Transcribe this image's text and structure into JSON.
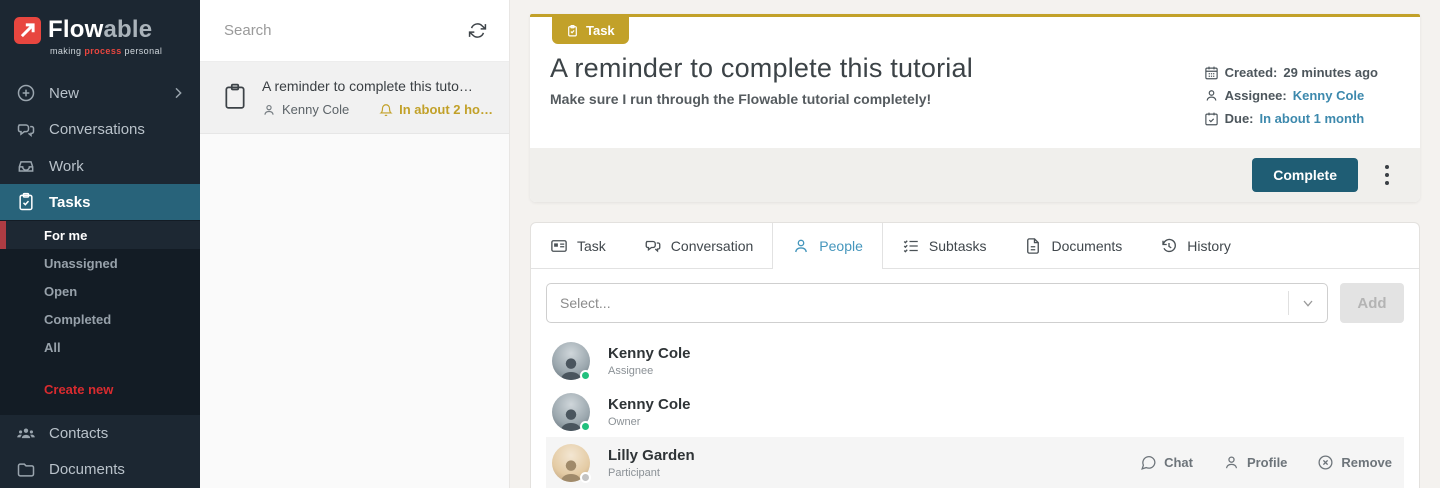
{
  "brand": {
    "name_primary": "Flow",
    "name_secondary": "able",
    "tagline_1": "making ",
    "tagline_accent": "process",
    "tagline_2": " personal"
  },
  "sidebar": {
    "items": [
      {
        "label": "New"
      },
      {
        "label": "Conversations"
      },
      {
        "label": "Work"
      },
      {
        "label": "Tasks"
      },
      {
        "label": "Contacts"
      },
      {
        "label": "Documents"
      }
    ],
    "task_filters": [
      {
        "label": "For me"
      },
      {
        "label": "Unassigned"
      },
      {
        "label": "Open"
      },
      {
        "label": "Completed"
      },
      {
        "label": "All"
      }
    ],
    "create_new_label": "Create new"
  },
  "task_list": {
    "search_placeholder": "Search",
    "items": [
      {
        "title": "A reminder to complete this tuto…",
        "assignee": "Kenny Cole",
        "due": "In about 2 ho…"
      }
    ]
  },
  "task_detail": {
    "badge": "Task",
    "title": "A reminder to complete this tutorial",
    "description": "Make sure I run through the Flowable tutorial completely!",
    "created_label": "Created:",
    "created_value": "29 minutes ago",
    "assignee_label": "Assignee:",
    "assignee_value": "Kenny Cole",
    "due_label": "Due:",
    "due_value": "In about 1 month",
    "complete_button": "Complete"
  },
  "tabs": [
    {
      "label": "Task"
    },
    {
      "label": "Conversation"
    },
    {
      "label": "People",
      "active": true
    },
    {
      "label": "Subtasks"
    },
    {
      "label": "Documents"
    },
    {
      "label": "History"
    }
  ],
  "people_panel": {
    "select_placeholder": "Select...",
    "add_button": "Add",
    "people": [
      {
        "name": "Kenny Cole",
        "role": "Assignee",
        "status": "online"
      },
      {
        "name": "Kenny Cole",
        "role": "Owner",
        "status": "online"
      },
      {
        "name": "Lilly Garden",
        "role": "Participant",
        "status": "offline"
      }
    ],
    "row_actions": [
      {
        "label": "Chat"
      },
      {
        "label": "Profile"
      },
      {
        "label": "Remove"
      }
    ]
  },
  "colors": {
    "brand_red": "#e8463f",
    "accent_red": "#d92b2f",
    "gold": "#c2a129",
    "sidebar_bg": "#1c2732",
    "sidebar_submenu_bg": "#131c25",
    "sidebar_active_teal": "#28637a",
    "complete_teal": "#1f5d74",
    "link_blue": "#3d89ad",
    "tab_active_blue": "#4596bc",
    "online_green": "#21c07d"
  }
}
